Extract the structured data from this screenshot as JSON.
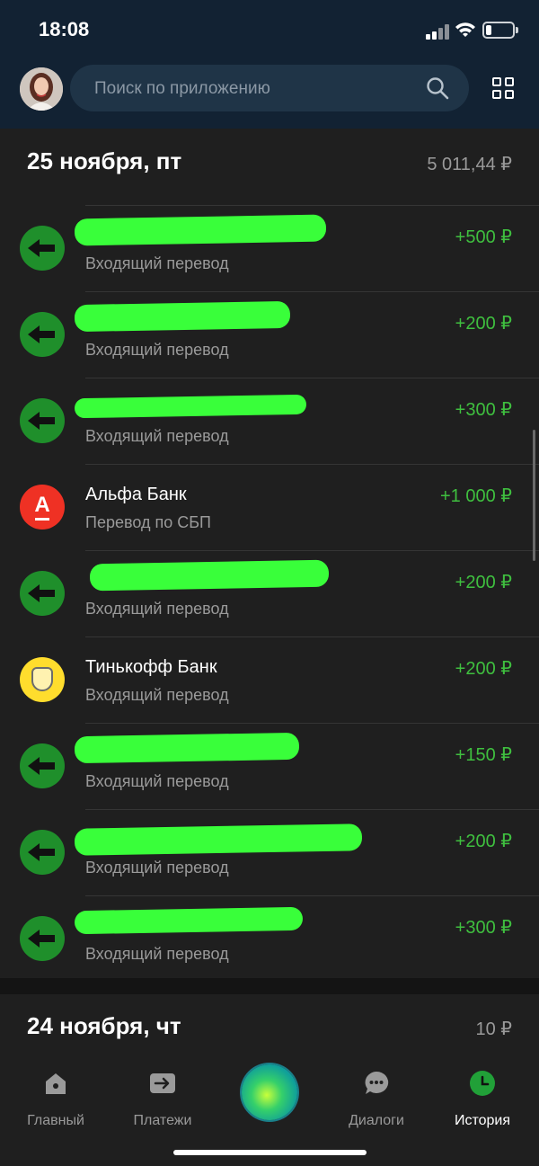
{
  "status": {
    "time": "18:08"
  },
  "search": {
    "placeholder": "Поиск по приложению"
  },
  "days": [
    {
      "title": "25 ноября, пт",
      "total": "5 011,44 ₽"
    },
    {
      "title": "24 ноября, чт",
      "total": "10 ₽"
    }
  ],
  "transactions": [
    {
      "name": "",
      "subtitle": "Входящий перевод",
      "amount": "+500 ₽",
      "icon": "incoming-transfer-icon"
    },
    {
      "name": "",
      "subtitle": "Входящий перевод",
      "amount": "+200 ₽",
      "icon": "incoming-transfer-icon"
    },
    {
      "name": "",
      "subtitle": "Входящий перевод",
      "amount": "+300 ₽",
      "icon": "incoming-transfer-icon"
    },
    {
      "name": "Альфа Банк",
      "subtitle": "Перевод по СБП",
      "amount": "+1 000 ₽",
      "icon": "alfa-bank-icon",
      "letter": "А"
    },
    {
      "name": "",
      "subtitle": "Входящий перевод",
      "amount": "+200 ₽",
      "icon": "incoming-transfer-icon"
    },
    {
      "name": "Тинькофф Банк",
      "subtitle": "Входящий перевод",
      "amount": "+200 ₽",
      "icon": "tinkoff-bank-icon"
    },
    {
      "name": "",
      "subtitle": "Входящий перевод",
      "amount": "+150 ₽",
      "icon": "incoming-transfer-icon"
    },
    {
      "name": "",
      "subtitle": "Входящий перевод",
      "amount": "+200 ₽",
      "icon": "incoming-transfer-icon"
    },
    {
      "name": "",
      "subtitle": "Входящий перевод",
      "amount": "+300 ₽",
      "icon": "incoming-transfer-icon"
    }
  ],
  "tabs": [
    {
      "label": "Главный",
      "icon": "home-icon"
    },
    {
      "label": "Платежи",
      "icon": "payments-icon"
    },
    {
      "label": "",
      "icon": "assistant-orb-icon"
    },
    {
      "label": "Диалоги",
      "icon": "chat-icon"
    },
    {
      "label": "История",
      "icon": "history-clock-icon",
      "active": true
    }
  ],
  "colors": {
    "accent": "#21a038",
    "income": "#3fbf3f",
    "header": "#122233"
  }
}
